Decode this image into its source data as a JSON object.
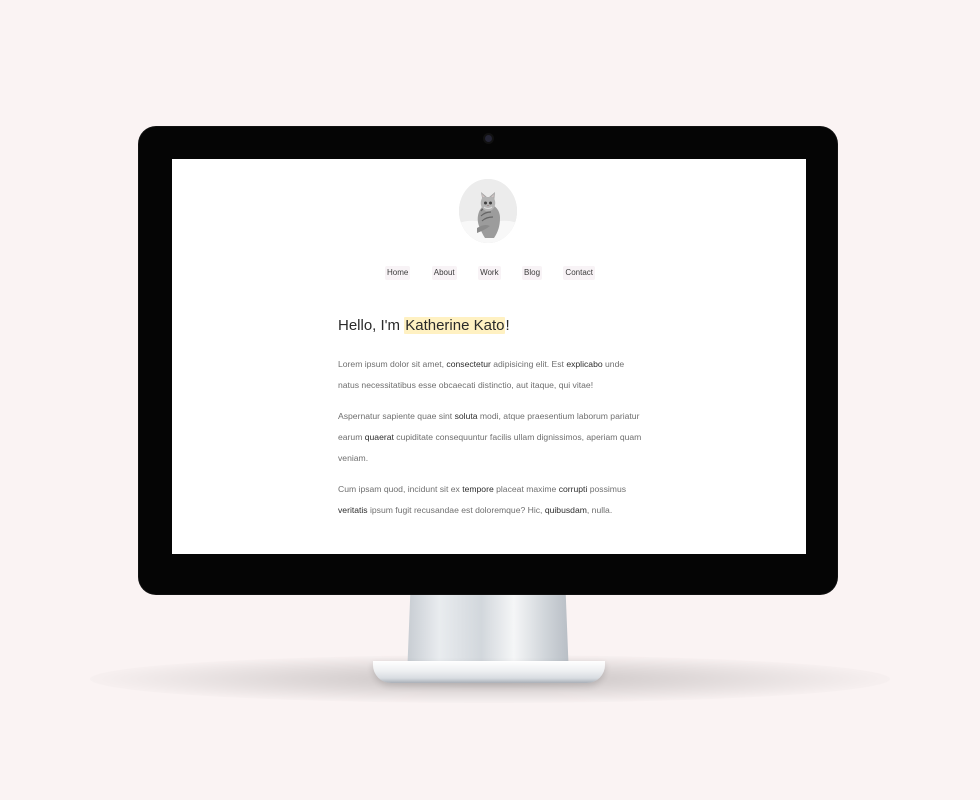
{
  "nav": {
    "items": [
      {
        "label": "Home"
      },
      {
        "label": "About"
      },
      {
        "label": "Work"
      },
      {
        "label": "Blog"
      },
      {
        "label": "Contact"
      }
    ]
  },
  "hero": {
    "greeting": "Hello, I'm ",
    "name": "Katherine Kato",
    "punctuation": "!"
  },
  "paragraphs": {
    "p1": {
      "a": "Lorem ipsum dolor sit amet, ",
      "b": "consectetur",
      "c": " adipisicing elit. Est ",
      "d": "explicabo",
      "e": " unde natus necessitatibus esse obcaecati distinctio, aut itaque, qui vitae!"
    },
    "p2": {
      "a": "Aspernatur sapiente quae sint ",
      "b": "soluta",
      "c": " modi, atque praesentium laborum pariatur earum ",
      "d": "quaerat",
      "e": " cupiditate consequuntur facilis ullam dignissimos, aperiam quam veniam."
    },
    "p3": {
      "a": "Cum ipsam quod, incidunt sit ex ",
      "b": "tempore",
      "c": " placeat maxime ",
      "d": "corrupti",
      "e": " possimus ",
      "f": "veritatis",
      "g": " ipsum fugit recusandae est doloremque? Hic, ",
      "h": "quibusdam",
      "i": ", nulla."
    }
  },
  "colors": {
    "page_background": "#faf3f3",
    "name_highlight": "#fff1c2",
    "text": "#6f6f6f",
    "heading": "#2a2a2a"
  },
  "icons": {
    "avatar": "cat-avatar",
    "camera": "camera-icon"
  }
}
